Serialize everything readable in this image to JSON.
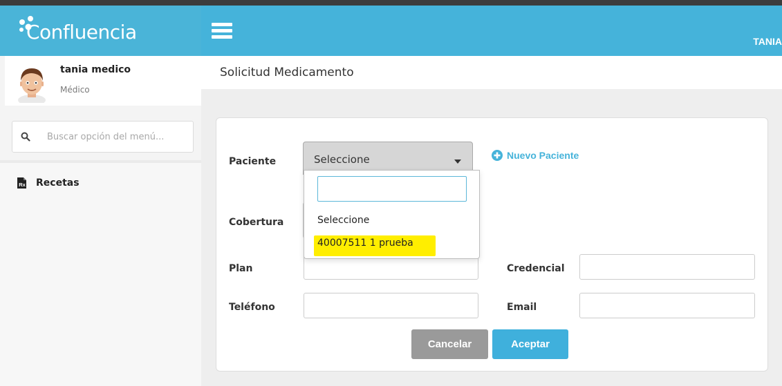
{
  "brand": {
    "name": "Confluencia"
  },
  "topbar": {
    "user_label": "TANIA"
  },
  "profile": {
    "name": "tania medico",
    "role": "Médico"
  },
  "search": {
    "placeholder": "Buscar opción del menú..."
  },
  "menu": {
    "items": [
      {
        "label": "Recetas",
        "icon": "prescription-file-icon"
      }
    ]
  },
  "page": {
    "title": "Solicitud Medicamento"
  },
  "form": {
    "paciente": {
      "label": "Paciente",
      "selected": "Seleccione"
    },
    "new_patient_label": "Nuevo Paciente",
    "cobertura_label": "Cobertura",
    "plan_label": "Plan",
    "credencial_label": "Credencial",
    "telefono_label": "Teléfono",
    "email_label": "Email",
    "dropdown": {
      "search_value": "",
      "options": [
        "Seleccione",
        "40007511 1 prueba"
      ],
      "highlighted_index": 1
    },
    "buttons": {
      "cancel": "Cancelar",
      "accept": "Aceptar"
    }
  },
  "colors": {
    "primary": "#45b3da",
    "highlight": "#ffee00",
    "cancel": "#9a9a9a"
  }
}
